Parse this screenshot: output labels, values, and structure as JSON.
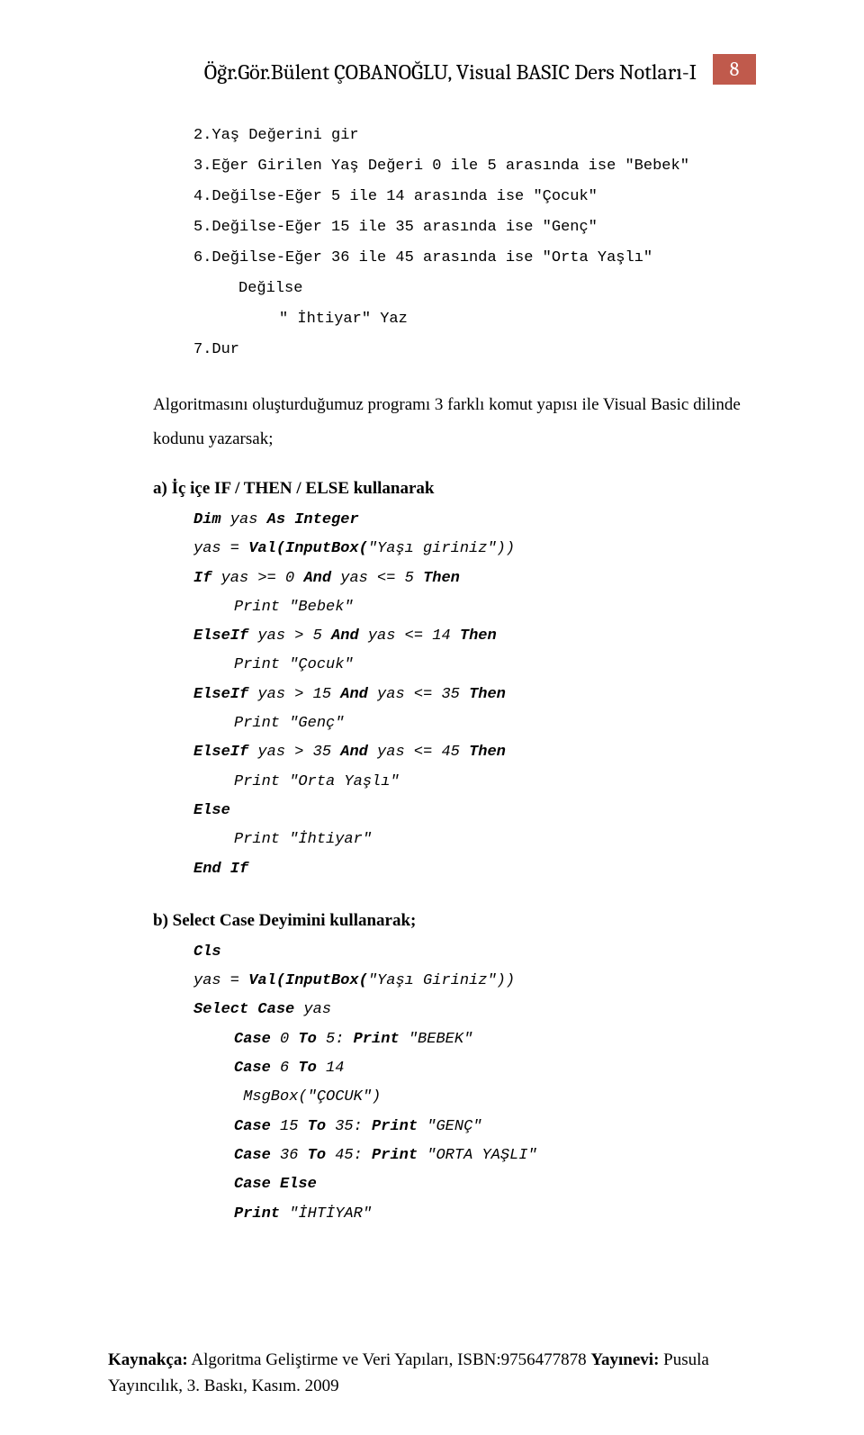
{
  "header": {
    "title": "Öğr.Gör.Bülent ÇOBANOĞLU, Visual BASIC Ders Notları-I",
    "page_number": "8"
  },
  "algo": {
    "l1": "2.Yaş Değerini gir",
    "l2": "3.Eğer Girilen Yaş Değeri 0 ile 5 arasında ise \"Bebek\"",
    "l3": "4.Değilse-Eğer 5 ile 14 arasında ise \"Çocuk\"",
    "l4": "5.Değilse-Eğer 15 ile 35 arasında ise \"Genç\"",
    "l5": "6.Değilse-Eğer 36 ile 45 arasında ise \"Orta Yaşlı\"",
    "l6": "Değilse",
    "l7": "\" İhtiyar\" Yaz",
    "l8": "7.Dur"
  },
  "para1": "Algoritmasını oluşturduğumuz programı 3 farklı komut yapısı ile Visual Basic dilinde kodunu yazarsak;",
  "section_a": "a) İç içe IF / THEN / ELSE kullanarak",
  "code_a": {
    "c1a": "Dim",
    "c1b": " yas ",
    "c1c": "As Integer",
    "c2a": "yas = ",
    "c2b": "Val(InputBox(",
    "c2c": "\"Yaşı giriniz\"))",
    "c3a": "If",
    "c3b": " yas >= 0 ",
    "c3c": "And",
    "c3d": " yas <= 5 ",
    "c3e": "Then",
    "c4": "Print \"Bebek\"",
    "c5a": "ElseIf",
    "c5b": " yas > 5 ",
    "c5c": "And",
    "c5d": " yas <= 14 ",
    "c5e": "Then",
    "c6": "Print \"Çocuk\"",
    "c7a": "ElseIf",
    "c7b": " yas > 15 ",
    "c7c": "And",
    "c7d": " yas <= 35 ",
    "c7e": "Then",
    "c8": "Print \"Genç\"",
    "c9a": "ElseIf",
    "c9b": " yas > 35 ",
    "c9c": "And",
    "c9d": " yas <= 45 ",
    "c9e": "Then",
    "c10": "Print \"Orta Yaşlı\"",
    "c11": "Else",
    "c12": "Print \"İhtiyar\"",
    "c13": "End If"
  },
  "section_b": "b) Select Case Deyimini kullanarak;",
  "code_b": {
    "d1": "Cls",
    "d2a": "yas = ",
    "d2b": "Val(InputBox(",
    "d2c": "\"Yaşı Giriniz\"))",
    "d3a": "Select Case",
    "d3b": " yas",
    "d4a": "Case",
    "d4b": " 0 ",
    "d4c": "To",
    "d4d": " 5: ",
    "d4e": "Print",
    "d4f": " \"BEBEK\"",
    "d5a": "Case",
    "d5b": " 6 ",
    "d5c": "To",
    "d5d": " 14",
    "d6": " MsgBox(\"ÇOCUK\")",
    "d7a": "Case",
    "d7b": " 15 ",
    "d7c": "To",
    "d7d": " 35: ",
    "d7e": "Print",
    "d7f": " \"GENÇ\"",
    "d8a": "Case",
    "d8b": " 36 ",
    "d8c": "To",
    "d8d": " 45: ",
    "d8e": "Print",
    "d8f": " \"ORTA YAŞLI\"",
    "d9": "Case Else",
    "d10a": "Print",
    "d10b": " \"İHTİYAR\""
  },
  "footer": {
    "label1": "Kaynakça:",
    "text1": " Algoritma Geliştirme ve Veri Yapıları, ISBN:9756477878 ",
    "label2": "Yayınevi:",
    "text2": " Pusula Yayıncılık, 3. Baskı, Kasım. 2009"
  }
}
